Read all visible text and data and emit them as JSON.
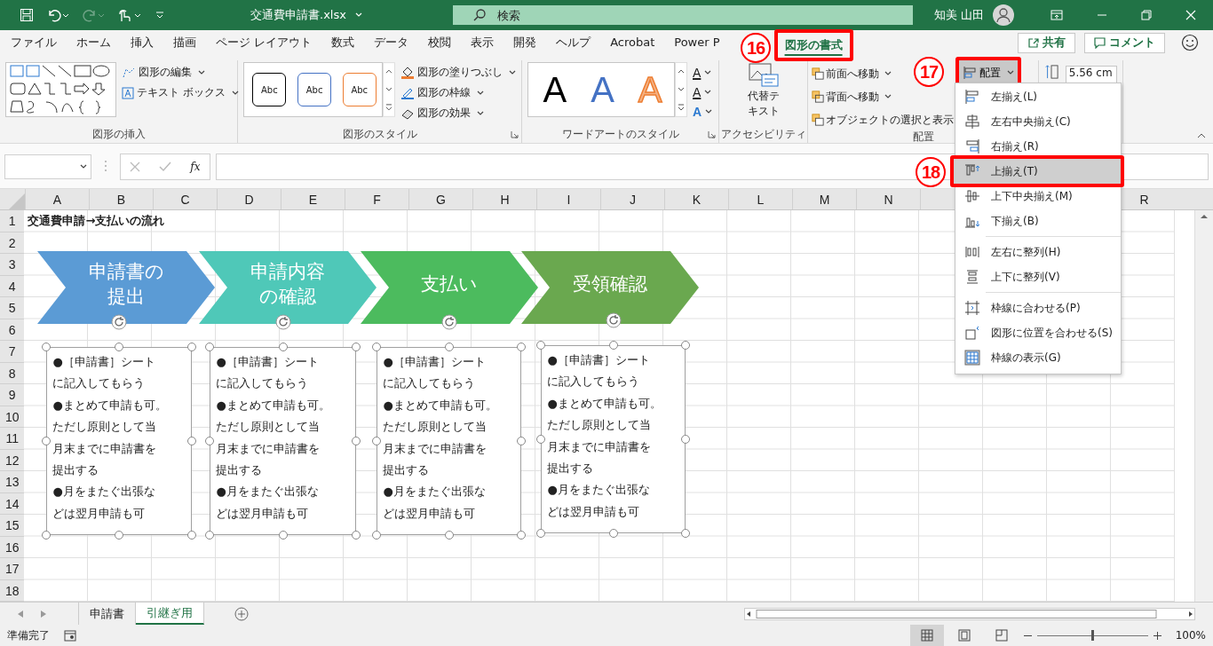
{
  "title_bar": {
    "filename": "交通費申請書.xlsx",
    "search_placeholder": "検索",
    "user": "知美 山田"
  },
  "ribbon_tabs": [
    {
      "label": "ファイル",
      "selected": false,
      "highlighted": false
    },
    {
      "label": "ホーム",
      "selected": false,
      "highlighted": false
    },
    {
      "label": "挿入",
      "selected": false,
      "highlighted": false
    },
    {
      "label": "描画",
      "selected": false,
      "highlighted": false
    },
    {
      "label": "ページ レイアウト",
      "selected": false,
      "highlighted": false
    },
    {
      "label": "数式",
      "selected": false,
      "highlighted": false
    },
    {
      "label": "データ",
      "selected": false,
      "highlighted": false
    },
    {
      "label": "校閲",
      "selected": false,
      "highlighted": false
    },
    {
      "label": "表示",
      "selected": false,
      "highlighted": false
    },
    {
      "label": "開発",
      "selected": false,
      "highlighted": false
    },
    {
      "label": "ヘルプ",
      "selected": false,
      "highlighted": false
    },
    {
      "label": "Acrobat",
      "selected": false,
      "highlighted": false
    },
    {
      "label": "Power P",
      "selected": false,
      "highlighted": false
    },
    {
      "label": "図形の書式",
      "selected": true,
      "highlighted": true
    }
  ],
  "share_button": "共有",
  "comment_button": "コメント",
  "insert_shapes": {
    "label": "図形の挿入",
    "buttons": [
      "図形の編集",
      "テキスト ボックス"
    ]
  },
  "shape_styles": {
    "label": "図形のスタイル",
    "presets": [
      {
        "text": "Abc",
        "color": "#000000"
      },
      {
        "text": "Abc",
        "color": "#4472c4"
      },
      {
        "text": "Abc",
        "color": "#ed7d31"
      }
    ],
    "buttons": [
      "図形の塗りつぶし",
      "図形の枠線",
      "図形の効果"
    ]
  },
  "wordart": {
    "label": "ワードアートのスタイル",
    "presets": [
      {
        "text": "A",
        "color": "#000000"
      },
      {
        "text": "A",
        "color": "#4472c4"
      },
      {
        "text": "A",
        "color": "#f4b183"
      }
    ],
    "buttons": [
      "A",
      "A",
      "A"
    ]
  },
  "accessibility": {
    "label": "アクセシビリティ",
    "button": "代替テキスト"
  },
  "arrange": {
    "label": "配置",
    "buttons": [
      "前面へ移動",
      "背面へ移動",
      "オブジェクトの選択と表示"
    ],
    "align_button": {
      "label": "配置",
      "highlighted": true
    }
  },
  "size": {
    "height": "5.56 cm"
  },
  "annotations": [
    "16",
    "17",
    "18"
  ],
  "formula_bar": {
    "fx": "fx"
  },
  "sheet": {
    "columns": [
      "A",
      "B",
      "C",
      "D",
      "E",
      "F",
      "G",
      "H",
      "I",
      "J",
      "K",
      "L",
      "M",
      "N",
      "R"
    ],
    "rows": [
      "1",
      "2",
      "3",
      "4",
      "5",
      "6",
      "7",
      "8",
      "9",
      "10",
      "11",
      "12",
      "13",
      "14",
      "15",
      "16",
      "17",
      "18"
    ],
    "title": "交通費申請→支払いの流れ",
    "steps": [
      {
        "lines": [
          "申請書の",
          "提出"
        ],
        "color": "#5b9bd5"
      },
      {
        "lines": [
          "申請内容",
          "の確認"
        ],
        "color": "#4fc8b8"
      },
      {
        "lines": [
          "支払い"
        ],
        "color": "#4cbb5e"
      },
      {
        "lines": [
          "受領確認"
        ],
        "color": "#6aa84f"
      }
    ],
    "notes": [
      {
        "lines": [
          "●［申請書］シート",
          "に記入してもらう",
          "●まとめて申請も可。",
          "ただし原則として当",
          "月末までに申請書を",
          "提出する",
          "●月をまたぐ出張な",
          "どは翌月申請も可"
        ]
      },
      {
        "lines": [
          "●［申請書］シート",
          "に記入してもらう",
          "●まとめて申請も可。",
          "ただし原則として当",
          "月末までに申請書を",
          "提出する",
          "●月をまたぐ出張な",
          "どは翌月申請も可"
        ]
      },
      {
        "lines": [
          "●［申請書］シート",
          "に記入してもらう",
          "●まとめて申請も可。",
          "ただし原則として当",
          "月末までに申請書を",
          "提出する",
          "●月をまたぐ出張な",
          "どは翌月申請も可"
        ]
      },
      {
        "lines": [
          "●［申請書］シート",
          "に記入してもらう",
          "●まとめて申請も可。",
          "ただし原則として当",
          "月末までに申請書を",
          "提出する",
          "●月をまたぐ出張な",
          "どは翌月申請も可"
        ]
      }
    ]
  },
  "menu": {
    "groups": [
      [
        {
          "label": "左揃え(L)",
          "selected": false,
          "highlighted": false
        },
        {
          "label": "左右中央揃え(C)",
          "selected": false,
          "highlighted": false
        },
        {
          "label": "右揃え(R)",
          "selected": false,
          "highlighted": false
        },
        {
          "label": "上揃え(T)",
          "selected": true,
          "highlighted": true
        },
        {
          "label": "上下中央揃え(M)",
          "selected": false,
          "highlighted": false
        },
        {
          "label": "下揃え(B)",
          "selected": false,
          "highlighted": false
        }
      ],
      [
        {
          "label": "左右に整列(H)",
          "selected": false,
          "highlighted": false
        },
        {
          "label": "上下に整列(V)",
          "selected": false,
          "highlighted": false
        }
      ],
      [
        {
          "label": "枠線に合わせる(P)",
          "selected": false,
          "highlighted": false
        },
        {
          "label": "図形に位置を合わせる(S)",
          "selected": false,
          "highlighted": false
        },
        {
          "label": "枠線の表示(G)",
          "selected": false,
          "highlighted": false
        }
      ]
    ]
  },
  "sheet_tabs": [
    {
      "label": "申請書",
      "selected": false
    },
    {
      "label": "引継ぎ用",
      "selected": true
    }
  ],
  "status_bar": {
    "text": "準備完了",
    "views": [
      {
        "selected": true
      },
      {
        "selected": false
      },
      {
        "selected": false
      }
    ],
    "zoom": {
      "level": 0.5,
      "text": "100%"
    }
  }
}
